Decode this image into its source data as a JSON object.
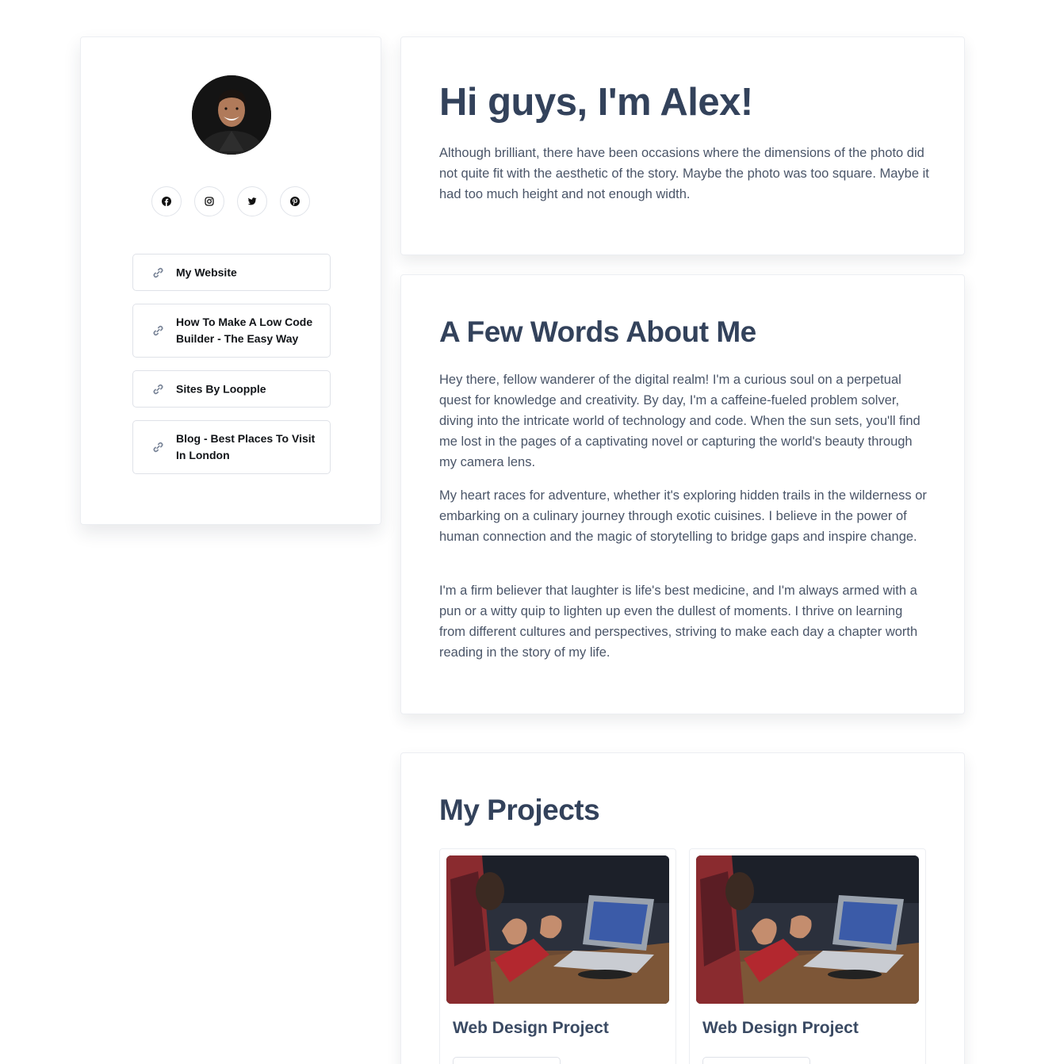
{
  "profile": {
    "avatar_alt": "Profile photo",
    "social": [
      {
        "name": "facebook",
        "icon": "facebook-icon"
      },
      {
        "name": "instagram",
        "icon": "instagram-icon"
      },
      {
        "name": "twitter",
        "icon": "twitter-icon"
      },
      {
        "name": "pinterest",
        "icon": "pinterest-icon"
      }
    ],
    "links": [
      {
        "label": "My Website",
        "icon": "link-icon"
      },
      {
        "label": "How To Make A Low Code Builder - The Easy Way",
        "icon": "link-icon"
      },
      {
        "label": "Sites By Loopple",
        "icon": "link-icon"
      },
      {
        "label": "Blog - Best Places To Visit In London",
        "icon": "link-icon"
      }
    ]
  },
  "intro": {
    "title": "Hi guys, I'm Alex!",
    "text": "Although brilliant, there have been occasions where the dimensions of the photo did not quite fit with the aesthetic of the story. Maybe the photo was too square. Maybe it had too much height and not enough width."
  },
  "about": {
    "title": "A Few Words About Me",
    "paragraphs": [
      "Hey there, fellow wanderer of the digital realm! I'm a curious soul on a perpetual quest for knowledge and creativity. By day, I'm a caffeine-fueled problem solver, diving into the intricate world of technology and code. When the sun sets, you'll find me lost in the pages of a captivating novel or capturing the world's beauty through my camera lens.",
      "My heart races for adventure, whether it's exploring hidden trails in the wilderness or embarking on a culinary journey through exotic cuisines. I believe in the power of human connection and the magic of storytelling to bridge gaps and inspire change.",
      "I'm a firm believer that laughter is life's best medicine, and I'm always armed with a pun or a witty quip to lighten up even the dullest of moments. I thrive on learning from different cultures and perspectives, striving to make each day a chapter worth reading in the story of my life."
    ]
  },
  "projects": {
    "title": "My Projects",
    "items": [
      {
        "title": "Web Design Project",
        "image": "meeting-laptop-photo"
      },
      {
        "title": "Web Design Project",
        "image": "meeting-laptop-photo"
      }
    ]
  },
  "colors": {
    "heading": "#33425b",
    "body_text": "#4a5568",
    "border": "#dfe2e8"
  }
}
